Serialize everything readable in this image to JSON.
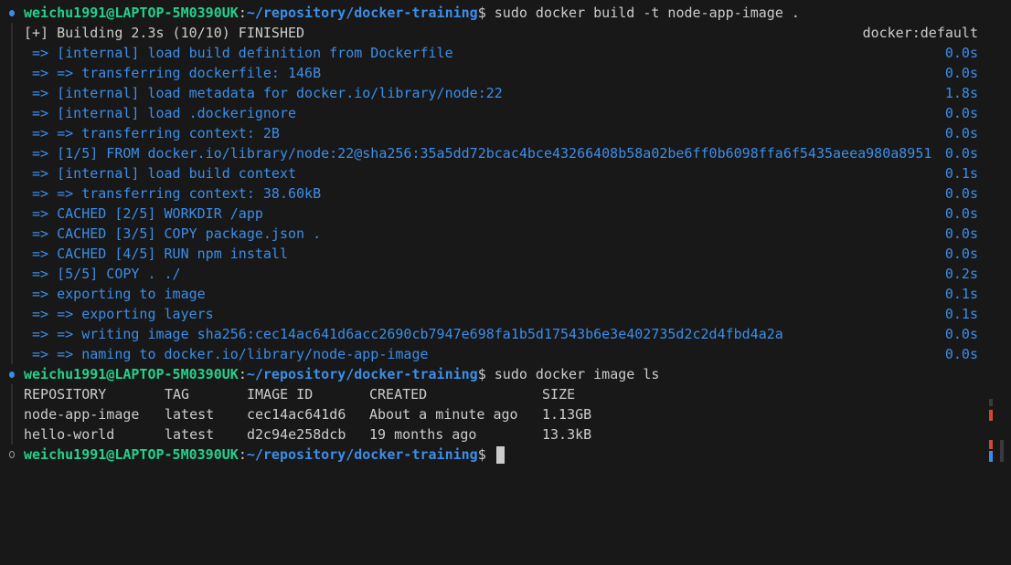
{
  "colors": {
    "background": "#181818",
    "prompt_user": "#23d18b",
    "prompt_path": "#3b8eea",
    "build_step": "#3b8eea",
    "text": "#cccccc",
    "decorator_blue": "#3a8ee6"
  },
  "prompt": {
    "user": "weichu1991@LAPTOP-5M0390UK",
    "path": "~/repository/docker-training"
  },
  "commands": [
    "sudo docker build -t node-app-image .",
    "sudo docker image ls"
  ],
  "build": {
    "header": "[+] Building 2.3s (10/10) FINISHED",
    "context": "docker:default",
    "steps": [
      {
        "text": " => [internal] load build definition from Dockerfile",
        "time": "0.0s"
      },
      {
        "text": " => => transferring dockerfile: 146B",
        "time": "0.0s"
      },
      {
        "text": " => [internal] load metadata for docker.io/library/node:22",
        "time": "1.8s"
      },
      {
        "text": " => [internal] load .dockerignore",
        "time": "0.0s"
      },
      {
        "text": " => => transferring context: 2B",
        "time": "0.0s"
      },
      {
        "text": " => [1/5] FROM docker.io/library/node:22@sha256:35a5dd72bcac4bce43266408b58a02be6ff0b6098ffa6f5435aeea980a8951",
        "time": "0.0s"
      },
      {
        "text": " => [internal] load build context",
        "time": "0.1s"
      },
      {
        "text": " => => transferring context: 38.60kB",
        "time": "0.0s"
      },
      {
        "text": " => CACHED [2/5] WORKDIR /app",
        "time": "0.0s"
      },
      {
        "text": " => CACHED [3/5] COPY package.json .",
        "time": "0.0s"
      },
      {
        "text": " => CACHED [4/5] RUN npm install",
        "time": "0.0s"
      },
      {
        "text": " => [5/5] COPY . ./",
        "time": "0.2s"
      },
      {
        "text": " => exporting to image",
        "time": "0.1s"
      },
      {
        "text": " => => exporting layers",
        "time": "0.1s"
      },
      {
        "text": " => => writing image sha256:cec14ac641d6acc2690cb7947e698fa1b5d17543b6e3e402735d2c2d4fbd4a2a",
        "time": "0.0s"
      },
      {
        "text": " => => naming to docker.io/library/node-app-image",
        "time": "0.0s"
      }
    ]
  },
  "images_table": {
    "headers": [
      "REPOSITORY",
      "TAG",
      "IMAGE ID",
      "CREATED",
      "SIZE"
    ],
    "rows": [
      [
        "node-app-image",
        "latest",
        "cec14ac641d6",
        "About a minute ago",
        "1.13GB"
      ],
      [
        "hello-world",
        "latest",
        "d2c94e258dcb",
        "19 months ago",
        "13.3kB"
      ]
    ]
  }
}
